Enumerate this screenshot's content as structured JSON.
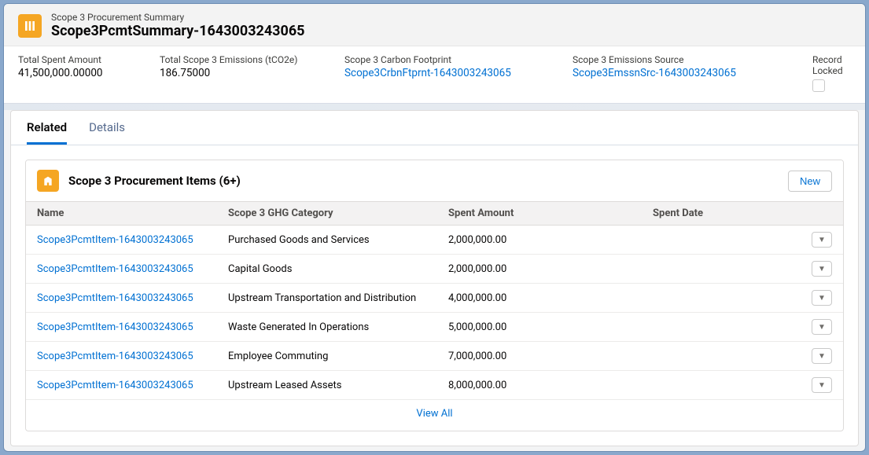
{
  "header": {
    "objectType": "Scope 3 Procurement Summary",
    "recordName": "Scope3PcmtSummary-1643003243065"
  },
  "summary": {
    "totalSpent": {
      "label": "Total Spent Amount",
      "value": "41,500,000.00000"
    },
    "totalEmissions": {
      "label": "Total Scope 3 Emissions (tCO2e)",
      "value": "186.75000"
    },
    "carbonFootprint": {
      "label": "Scope 3 Carbon Footprint",
      "value": "Scope3CrbnFtprnt-1643003243065"
    },
    "emissionsSource": {
      "label": "Scope 3 Emissions Source",
      "value": "Scope3EmssnSrc-1643003243065"
    },
    "recordLocked": {
      "label": "Record Locked"
    }
  },
  "tabs": {
    "related": "Related",
    "details": "Details"
  },
  "relatedList": {
    "title": "Scope 3 Procurement Items (6+)",
    "newLabel": "New",
    "viewAll": "View All",
    "columns": {
      "name": "Name",
      "category": "Scope 3 GHG Category",
      "amount": "Spent Amount",
      "date": "Spent Date"
    },
    "rows": [
      {
        "name": "Scope3PcmtItem-1643003243065",
        "category": "Purchased Goods and Services",
        "amount": "2,000,000.00",
        "date": ""
      },
      {
        "name": "Scope3PcmtItem-1643003243065",
        "category": "Capital Goods",
        "amount": "2,000,000.00",
        "date": ""
      },
      {
        "name": "Scope3PcmtItem-1643003243065",
        "category": "Upstream Transportation and Distribution",
        "amount": "4,000,000.00",
        "date": ""
      },
      {
        "name": "Scope3PcmtItem-1643003243065",
        "category": "Waste Generated In Operations",
        "amount": "5,000,000.00",
        "date": ""
      },
      {
        "name": "Scope3PcmtItem-1643003243065",
        "category": "Employee Commuting",
        "amount": "7,000,000.00",
        "date": ""
      },
      {
        "name": "Scope3PcmtItem-1643003243065",
        "category": "Upstream Leased Assets",
        "amount": "8,000,000.00",
        "date": ""
      }
    ]
  }
}
